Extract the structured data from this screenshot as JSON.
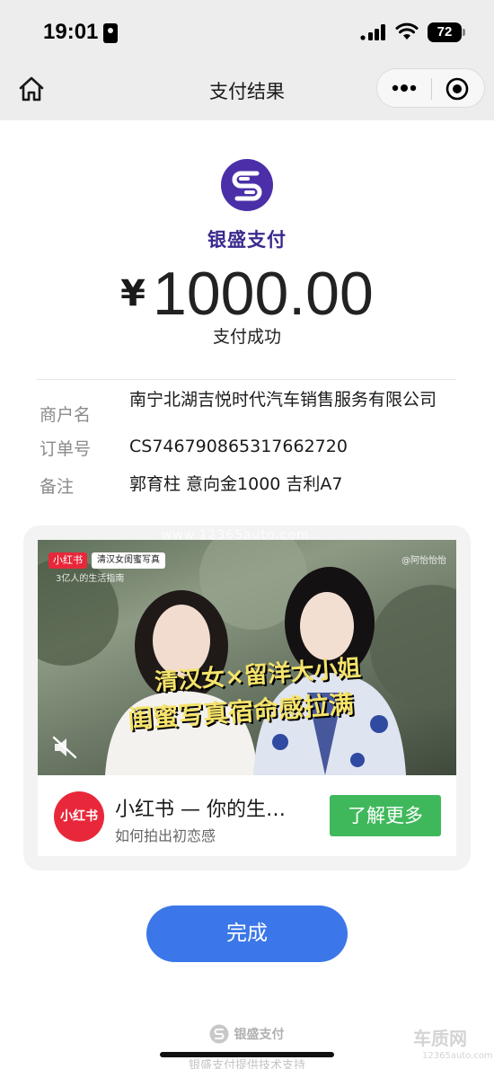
{
  "status_bar": {
    "time": "19:01",
    "battery": "72"
  },
  "nav": {
    "title": "支付结果"
  },
  "brand": {
    "name": "银盛支付",
    "color": "#4b2fa8"
  },
  "payment": {
    "currency": "¥",
    "amount": "1000.00",
    "status": "支付成功"
  },
  "details": [
    {
      "label": "商户名",
      "value": "南宁北湖吉悦时代汽车销售服务有限公司"
    },
    {
      "label": "订单号",
      "value": "CS746790865317662720"
    },
    {
      "label": "备注",
      "value": "郭育柱 意向金1000 吉利A7"
    }
  ],
  "ad": {
    "badge": "小红书",
    "badge_tag": "清汉女闺蜜写真",
    "tagline": "3亿人的生活指南",
    "author": "@阿怡怡怡",
    "headline_1": "清汉女×留洋大小姐",
    "headline_2": "闺蜜写真宿命感拉满",
    "app_icon_label": "小红书",
    "title": "小红书 — 你的生…",
    "subtitle": "如何拍出初恋感",
    "cta": "了解更多",
    "cta_color": "#3fb85b"
  },
  "done_button": "完成",
  "footer": {
    "brand": "银盛支付",
    "tech": "银盛支付提供技术支持"
  },
  "watermark": {
    "main": "车质网",
    "sub": "12365auto.com",
    "ad_overlay": "www.12365auto.com"
  }
}
